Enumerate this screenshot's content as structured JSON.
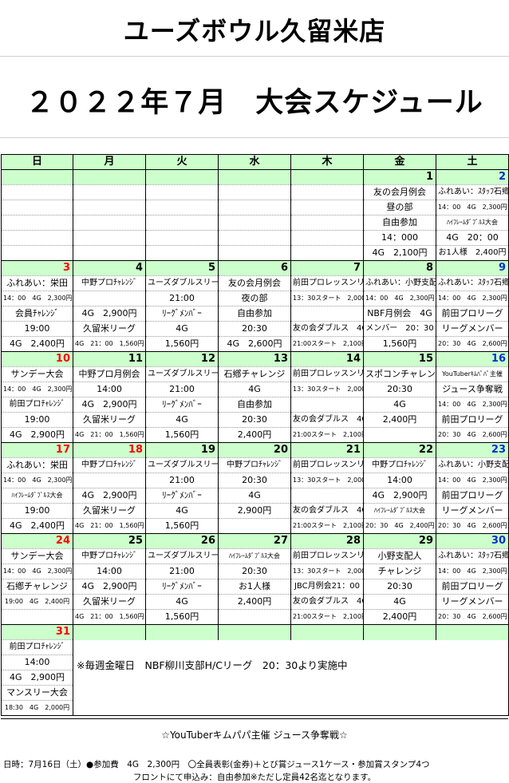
{
  "store_title": "ユーズボウル久留米店",
  "schedule_title": "２０２２年７月　大会スケジュール",
  "weekdays": [
    "日",
    "月",
    "火",
    "水",
    "木",
    "金",
    "土"
  ],
  "weeks": [
    {
      "days": [
        "",
        "",
        "",
        "",
        "",
        "1",
        "2"
      ],
      "rows": [
        [
          "",
          "",
          "",
          "",
          "",
          "友の会月例会",
          "ふれあい：ｽﾀｯﾌ石鄕"
        ],
        [
          "",
          "",
          "",
          "",
          "",
          "昼の部",
          "14：00　4G　2,300円"
        ],
        [
          "",
          "",
          "",
          "",
          "",
          "自由参加",
          "ﾊｲﾌﾚｰﾑﾀﾞﾌﾞﾙｽ大会"
        ],
        [
          "",
          "",
          "",
          "",
          "",
          "14：000",
          "4G　20：00"
        ],
        [
          "",
          "",
          "",
          "",
          "",
          "4G　2,100円",
          "お1人様　2,400円"
        ]
      ]
    },
    {
      "days": [
        "3",
        "4",
        "5",
        "6",
        "7",
        "8",
        "9"
      ],
      "rows": [
        [
          "ふれあい：栄田",
          "中野プロﾁｬﾚﾝｼﾞ",
          "ユーズダブルスリーグ",
          "友の会月例会",
          "前田プロレッスンリーグ",
          "ふれあい：小野支配人",
          "ふれあい：ｽﾀｯﾌ石鄕"
        ],
        [
          "14：00　4G　2,300円",
          "",
          "21:00",
          "夜の部",
          "13：30スタート　2,000円",
          "14：00　4G　2,300円",
          "14：00　4G　2,300円"
        ],
        [
          "会員ﾁｬﾚﾝｼﾞ",
          "4G　2,900円",
          "ﾘｰｸﾞﾒﾝﾊﾞｰ",
          "自由参加",
          "",
          "NBF月例会　4G",
          "前田プロリーグ"
        ],
        [
          "19:00",
          "久留米リーグ",
          "4G",
          "20:30",
          "友の会ダブルス　4G",
          "メンバー　20：30",
          "リーグメンバー"
        ],
        [
          "4G　2,400円",
          "4G　21：00　1,560円",
          "1,560円",
          "4G　2,600円",
          "21:00スタート　2,100円",
          "1,560円",
          "20：30　4G　2,600円"
        ]
      ]
    },
    {
      "days": [
        "10",
        "11",
        "12",
        "13",
        "14",
        "15",
        "16"
      ],
      "rows": [
        [
          "サンデー大会",
          "中野プロ月例会",
          "ユーズダブルスリーグ",
          "石鄕チャレンジ",
          "前田プロレッスンリーグ",
          "スポコンチャレンジ",
          "YouTuberｷﾑﾊﾟﾊﾟ主催"
        ],
        [
          "14：00　4G　2,300円",
          "14:00",
          "21:00",
          "4G",
          "13：30スタート　2,000円",
          "20:30",
          "ジュース争奪戦"
        ],
        [
          "前田プロﾁｬﾚﾝｼﾞ",
          "4G　2,900円",
          "ﾘｰｸﾞﾒﾝﾊﾞｰ",
          "自由参加",
          "",
          "4G",
          "14：00　4G　2,300円"
        ],
        [
          "19:00",
          "久留米リーグ",
          "4G",
          "20:30",
          "友の会ダブルス　4G",
          "2,400円",
          "前田プロリーグ"
        ],
        [
          "4G　2,900円",
          "4G　21：00　1,560円",
          "1,560円",
          "2,400円",
          "21:00スタート　2,100円",
          "",
          "20：30　4G　2,600円"
        ]
      ]
    },
    {
      "days": [
        "17",
        "18",
        "19",
        "20",
        "21",
        "22",
        "23"
      ],
      "rows": [
        [
          "ふれあい：栄田",
          "中野プロﾁｬﾚﾝｼﾞ",
          "ユーズダブルスリーグ",
          "中野プロﾁｬﾚﾝｼﾞ",
          "前田プロレッスンリーグ",
          "中野プロﾁｬﾚﾝｼﾞ",
          "ふれあい：小野支配人"
        ],
        [
          "14：00　4G　2,300円",
          "",
          "21:00",
          "20:30",
          "13：30スタート　2,000円",
          "14:00",
          "14：00　4G　2,300円"
        ],
        [
          "ﾊｲﾌﾚｰﾑﾀﾞﾌﾞﾙｽ大会",
          "4G　2,900円",
          "ﾘｰｸﾞﾒﾝﾊﾞｰ",
          "4G",
          "",
          "4G　2,900円",
          "前田プロリーグ"
        ],
        [
          "19:00",
          "久留米リーグ",
          "4G",
          "2,900円",
          "友の会ダブルス　4G",
          "ﾊｲﾌﾚｰﾑﾀﾞﾌﾞﾙｽ大会",
          "リーグメンバー"
        ],
        [
          "4G　2,400円",
          "4G　21：00　1,560円",
          "1,560円",
          "",
          "21:00スタート　2,100円",
          "20：30　4G　2,400円",
          "20：30　4G　2,600円"
        ]
      ]
    },
    {
      "days": [
        "24",
        "25",
        "26",
        "27",
        "28",
        "29",
        "30"
      ],
      "rows": [
        [
          "サンデー大会",
          "中野プロﾁｬﾚﾝｼﾞ",
          "ユーズダブルスリーグ",
          "ﾊｲﾌﾚｰﾑﾀﾞﾌﾞﾙｽ大会",
          "前田プロレッスンリーグ",
          "小野支配人",
          "ふれあい：ｽﾀｯﾌ石鄕"
        ],
        [
          "14：00　4G　2,300円",
          "14:00",
          "21:00",
          "20:30",
          "13：30スタート　2,000円",
          "チャレンジ",
          "14：00　4G　2,300円"
        ],
        [
          "石鄕チャレンジ",
          "4G　2,900円",
          "ﾘｰｸﾞﾒﾝﾊﾞｰ",
          "お1人様",
          "JBC月例会21：00",
          "20:30",
          "前田プロリーグ"
        ],
        [
          "19:00　4G　2,400円",
          "久留米リーグ",
          "4G",
          "2,400円",
          "友の会ダブルス　4G",
          "4G",
          "リーグメンバー"
        ],
        [
          "",
          "4G　21：00　1,560円",
          "1,560円",
          "",
          "21:00スタート　2,100円",
          "2,400円",
          "20：30　4G　2,600円"
        ]
      ]
    },
    {
      "days": [
        "31",
        "",
        "",
        "",
        "",
        "",
        ""
      ],
      "rows": [
        [
          "前田プロﾁｬﾚﾝｼﾞ",
          "",
          "",
          "",
          "",
          "",
          ""
        ],
        [
          "14:00",
          "",
          "",
          "",
          "",
          "",
          ""
        ],
        [
          "4G　2,900円",
          "",
          "",
          "",
          "",
          "",
          ""
        ],
        [
          "マンスリー大会",
          "",
          "",
          "",
          "",
          "",
          ""
        ],
        [
          "18:30　4G　2,000円",
          "",
          "",
          "",
          "",
          "",
          ""
        ]
      ]
    }
  ],
  "note": "※毎週金曜日　NBF柳川支部H/Cリーグ　20：30より実施中",
  "event": {
    "title": "☆YouTuberキムパパ主催 ジュース争奪戦☆",
    "detail1": "日時：7月16日（土）●参加費　4G　2,300円　〇全員表彰(金券)＋とび賞ジュース1ケース・参加賞スタンプ4つ",
    "detail2": "フロントにて申込み：自由参加※ただし定員42名迄となります。"
  }
}
